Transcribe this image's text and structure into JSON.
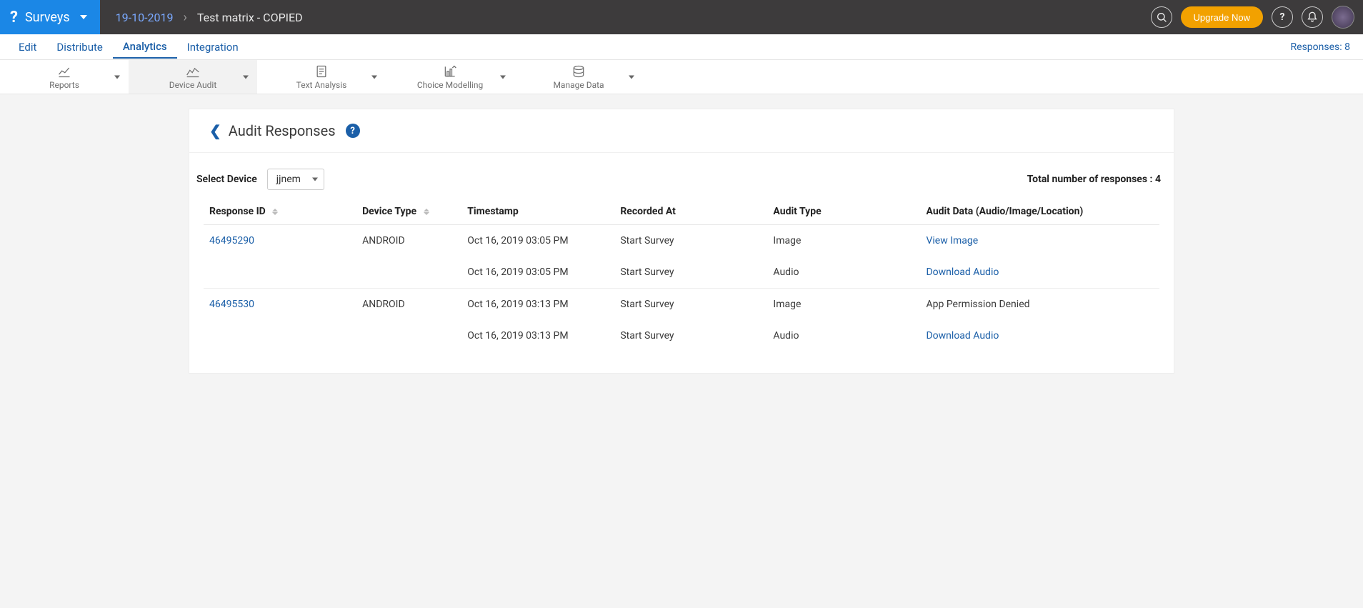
{
  "topbar": {
    "brand_label": "Surveys",
    "breadcrumb_date": "19-10-2019",
    "breadcrumb_title": "Test matrix - COPIED",
    "upgrade_label": "Upgrade Now"
  },
  "tabs": {
    "edit": "Edit",
    "distribute": "Distribute",
    "analytics": "Analytics",
    "integration": "Integration",
    "responses_label": "Responses: 8"
  },
  "tools": {
    "reports": "Reports",
    "device_audit": "Device Audit",
    "text_analysis": "Text Analysis",
    "choice_modelling": "Choice Modelling",
    "manage_data": "Manage Data"
  },
  "page": {
    "title": "Audit Responses",
    "select_device_label": "Select Device",
    "selected_device": "jjnem",
    "total_responses_label": "Total number of responses : 4"
  },
  "table": {
    "headers": {
      "response_id": "Response ID",
      "device_type": "Device Type",
      "timestamp": "Timestamp",
      "recorded_at": "Recorded At",
      "audit_type": "Audit Type",
      "audit_data": "Audit Data (Audio/Image/Location)"
    },
    "rows": [
      {
        "response_id": "46495290",
        "device_type": "ANDROID",
        "timestamp": "Oct 16, 2019 03:05 PM",
        "recorded_at": "Start Survey",
        "audit_type": "Image",
        "audit_data": "View Image",
        "audit_data_is_link": true,
        "group_start": true
      },
      {
        "response_id": "",
        "device_type": "",
        "timestamp": "Oct 16, 2019 03:05 PM",
        "recorded_at": "Start Survey",
        "audit_type": "Audio",
        "audit_data": "Download Audio",
        "audit_data_is_link": true,
        "group_start": false
      },
      {
        "response_id": "46495530",
        "device_type": "ANDROID",
        "timestamp": "Oct 16, 2019 03:13 PM",
        "recorded_at": "Start Survey",
        "audit_type": "Image",
        "audit_data": "App Permission Denied",
        "audit_data_is_link": false,
        "group_start": true
      },
      {
        "response_id": "",
        "device_type": "",
        "timestamp": "Oct 16, 2019 03:13 PM",
        "recorded_at": "Start Survey",
        "audit_type": "Audio",
        "audit_data": "Download Audio",
        "audit_data_is_link": true,
        "group_start": false
      }
    ]
  }
}
